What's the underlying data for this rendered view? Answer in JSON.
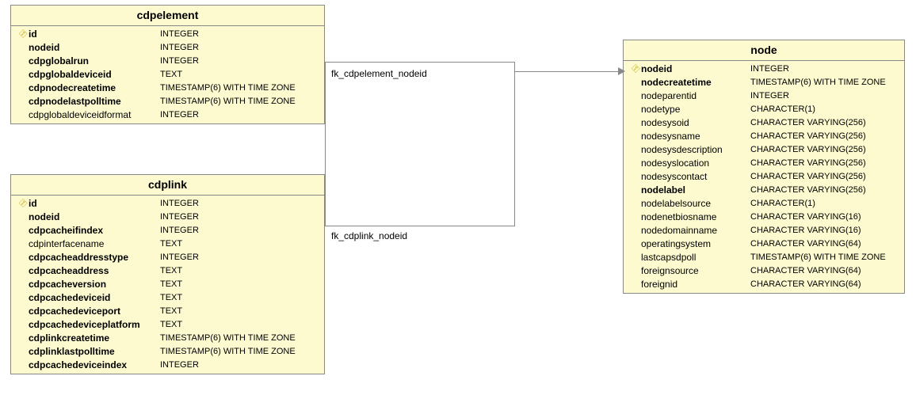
{
  "relationships": {
    "fk1": "fk_cdpelement_nodeid",
    "fk2": "fk_cdplink_nodeid"
  },
  "entities": {
    "cdpelement": {
      "title": "cdpelement",
      "columns": [
        {
          "pk": true,
          "bold": true,
          "name": "id",
          "type": "INTEGER"
        },
        {
          "pk": false,
          "bold": true,
          "name": "nodeid",
          "type": "INTEGER"
        },
        {
          "pk": false,
          "bold": true,
          "name": "cdpglobalrun",
          "type": "INTEGER"
        },
        {
          "pk": false,
          "bold": true,
          "name": "cdpglobaldeviceid",
          "type": "TEXT"
        },
        {
          "pk": false,
          "bold": true,
          "name": "cdpnodecreatetime",
          "type": "TIMESTAMP(6) WITH TIME ZONE"
        },
        {
          "pk": false,
          "bold": true,
          "name": "cdpnodelastpolltime",
          "type": "TIMESTAMP(6) WITH TIME ZONE"
        },
        {
          "pk": false,
          "bold": false,
          "name": "cdpglobaldeviceidformat",
          "type": "INTEGER"
        }
      ]
    },
    "cdplink": {
      "title": "cdplink",
      "columns": [
        {
          "pk": true,
          "bold": true,
          "name": "id",
          "type": "INTEGER"
        },
        {
          "pk": false,
          "bold": true,
          "name": "nodeid",
          "type": "INTEGER"
        },
        {
          "pk": false,
          "bold": true,
          "name": "cdpcacheifindex",
          "type": "INTEGER"
        },
        {
          "pk": false,
          "bold": false,
          "name": "cdpinterfacename",
          "type": "TEXT"
        },
        {
          "pk": false,
          "bold": true,
          "name": "cdpcacheaddresstype",
          "type": "INTEGER"
        },
        {
          "pk": false,
          "bold": true,
          "name": "cdpcacheaddress",
          "type": "TEXT"
        },
        {
          "pk": false,
          "bold": true,
          "name": "cdpcacheversion",
          "type": "TEXT"
        },
        {
          "pk": false,
          "bold": true,
          "name": "cdpcachedeviceid",
          "type": "TEXT"
        },
        {
          "pk": false,
          "bold": true,
          "name": "cdpcachedeviceport",
          "type": "TEXT"
        },
        {
          "pk": false,
          "bold": true,
          "name": "cdpcachedeviceplatform",
          "type": "TEXT"
        },
        {
          "pk": false,
          "bold": true,
          "name": "cdplinkcreatetime",
          "type": "TIMESTAMP(6) WITH TIME ZONE"
        },
        {
          "pk": false,
          "bold": true,
          "name": "cdplinklastpolltime",
          "type": "TIMESTAMP(6) WITH TIME ZONE"
        },
        {
          "pk": false,
          "bold": true,
          "name": "cdpcachedeviceindex",
          "type": "INTEGER"
        }
      ]
    },
    "node": {
      "title": "node",
      "columns": [
        {
          "pk": true,
          "bold": true,
          "name": "nodeid",
          "type": "INTEGER"
        },
        {
          "pk": false,
          "bold": true,
          "name": "nodecreatetime",
          "type": "TIMESTAMP(6) WITH TIME ZONE"
        },
        {
          "pk": false,
          "bold": false,
          "name": "nodeparentid",
          "type": "INTEGER"
        },
        {
          "pk": false,
          "bold": false,
          "name": "nodetype",
          "type": "CHARACTER(1)"
        },
        {
          "pk": false,
          "bold": false,
          "name": "nodesysoid",
          "type": "CHARACTER VARYING(256)"
        },
        {
          "pk": false,
          "bold": false,
          "name": "nodesysname",
          "type": "CHARACTER VARYING(256)"
        },
        {
          "pk": false,
          "bold": false,
          "name": "nodesysdescription",
          "type": "CHARACTER VARYING(256)"
        },
        {
          "pk": false,
          "bold": false,
          "name": "nodesyslocation",
          "type": "CHARACTER VARYING(256)"
        },
        {
          "pk": false,
          "bold": false,
          "name": "nodesyscontact",
          "type": "CHARACTER VARYING(256)"
        },
        {
          "pk": false,
          "bold": true,
          "name": "nodelabel",
          "type": "CHARACTER VARYING(256)"
        },
        {
          "pk": false,
          "bold": false,
          "name": "nodelabelsource",
          "type": "CHARACTER(1)"
        },
        {
          "pk": false,
          "bold": false,
          "name": "nodenetbiosname",
          "type": "CHARACTER VARYING(16)"
        },
        {
          "pk": false,
          "bold": false,
          "name": "nodedomainname",
          "type": "CHARACTER VARYING(16)"
        },
        {
          "pk": false,
          "bold": false,
          "name": "operatingsystem",
          "type": "CHARACTER VARYING(64)"
        },
        {
          "pk": false,
          "bold": false,
          "name": "lastcapsdpoll",
          "type": "TIMESTAMP(6) WITH TIME ZONE"
        },
        {
          "pk": false,
          "bold": false,
          "name": "foreignsource",
          "type": "CHARACTER VARYING(64)"
        },
        {
          "pk": false,
          "bold": false,
          "name": "foreignid",
          "type": "CHARACTER VARYING(64)"
        }
      ]
    }
  }
}
